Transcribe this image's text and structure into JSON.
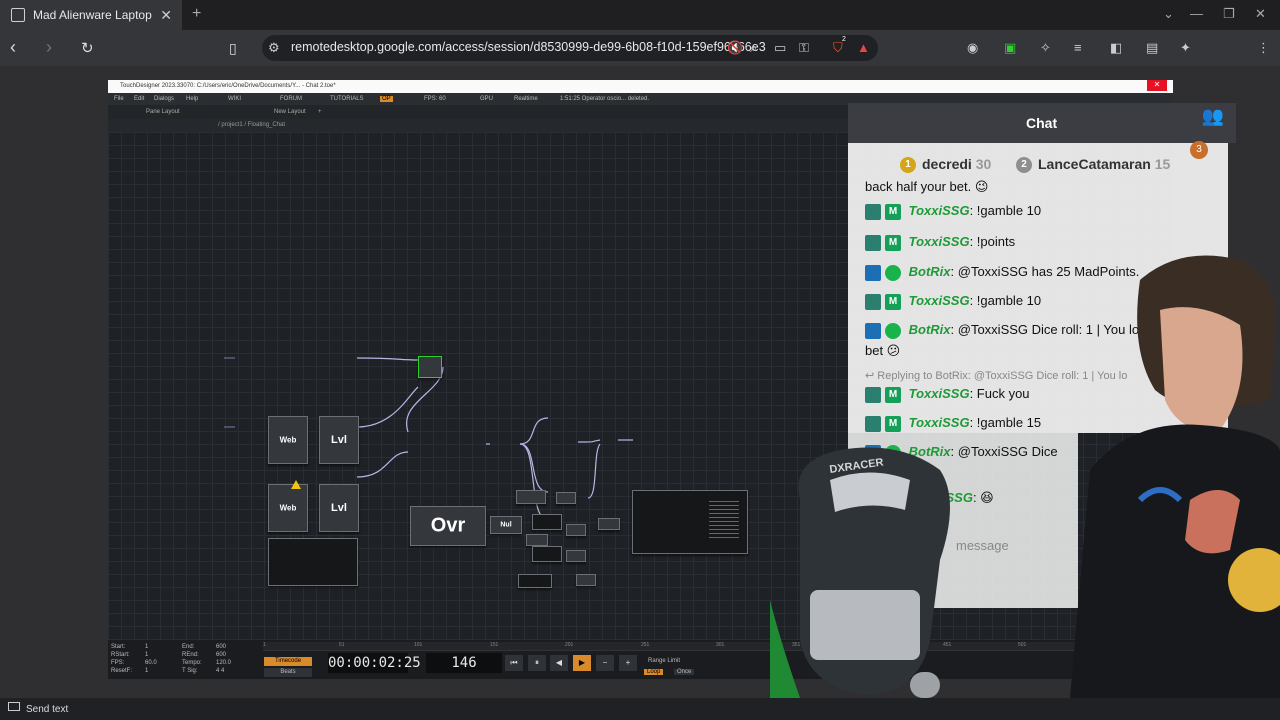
{
  "browser": {
    "tab_title": "Mad Alienware Laptop",
    "new_tab": "+",
    "url": "remotedesktop.google.com/access/session/d8530999-de99-6b08-f10d-159ef96366e3",
    "brave_badge": "2"
  },
  "touchdesigner": {
    "title": "TouchDesigner 2023.33070: C:/Users/eric/OneDrive/Documents/Y... - Chat 2.toe*",
    "menu": [
      "File",
      "Edit",
      "Dialogs",
      "Help"
    ],
    "toolbar": [
      "WIKI",
      "FORUM",
      "TUTORIALS",
      "OP",
      "FPS: 60",
      "GPU",
      "Realtime",
      "1:51:25 Operator oscio... deleted."
    ],
    "pane_layout": "Pane Layout",
    "new_layout": "New Layout",
    "path": "/ project1 / Floating_Chat",
    "operators": {
      "web1": "Web",
      "lvl1": "Lvl",
      "web2": "Web",
      "lvl2": "Lvl",
      "over": "Ovr",
      "null": "Nul"
    },
    "timeline": {
      "info_labels": [
        "Start:",
        "RStart:",
        "FPS:",
        "ResetF:"
      ],
      "info_values": [
        "1",
        "1",
        "60.0",
        "1"
      ],
      "info_labels2": [
        "End:",
        "REnd:",
        "Tempo:",
        "T Sig:"
      ],
      "info_values2": [
        "600",
        "600",
        "120.0",
        "4    4"
      ],
      "ticks": [
        "1",
        "51",
        "101",
        "151",
        "201",
        "251",
        "301",
        "351",
        "401",
        "451",
        "501"
      ],
      "timecode_label": "Timecode",
      "beats_label": "Beats",
      "timecode": "00:00:02:25",
      "frame": "146",
      "range_limit": "Range Limit",
      "loop": "Loop",
      "once": "Once"
    }
  },
  "chat": {
    "title": "Chat",
    "notif_count": "3",
    "top_users": [
      {
        "rank": "1",
        "name": "decredi",
        "points": "30"
      },
      {
        "rank": "2",
        "name": "LanceCatamaran",
        "points": "15"
      }
    ],
    "messages": [
      {
        "user": "",
        "text": "back half your bet. 😉"
      },
      {
        "user": "ToxxiSSG",
        "text": "!gamble 10"
      },
      {
        "user": "ToxxiSSG",
        "text": "!points"
      },
      {
        "user": "BotRix",
        "text": "@ToxxiSSG has 25 MadPoints."
      },
      {
        "user": "ToxxiSSG",
        "text": "!gamble 10"
      },
      {
        "user": "BotRix",
        "text": "@ToxxiSSG Dice roll: 1 | You lo"
      },
      {
        "user": "",
        "text": "bet 😕"
      },
      {
        "user": "",
        "text": "Replying to BotRix: @ToxxiSSG Dice roll: 1 | You lo"
      },
      {
        "user": "ToxxiSSG",
        "text": "Fuck you"
      },
      {
        "user": "ToxxiSSG",
        "text": "!gamble 15"
      },
      {
        "user": "BotRix",
        "text": "@ToxxiSSG Dice"
      },
      {
        "user": "",
        "text": "😕"
      },
      {
        "user": "ToxxiSSG",
        "text": "😆"
      }
    ],
    "input_placeholder": "message"
  },
  "bottom": {
    "send_text": "Send text"
  },
  "colors": {
    "accent_green": "#1e9a36",
    "td_play": "#d98a2b",
    "close_red": "#e81123"
  }
}
